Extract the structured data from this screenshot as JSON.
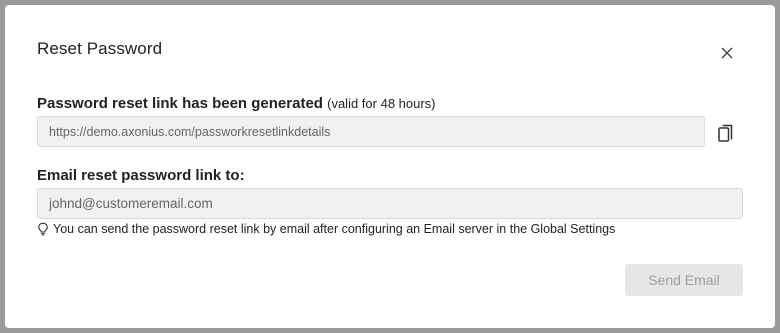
{
  "dialog": {
    "title": "Reset Password",
    "close_icon": "close-icon"
  },
  "link_section": {
    "label": "Password reset link has been generated",
    "note": "(valid for 48 hours)",
    "link_value": "https://demo.axonius.com/passworkresetlinkdetails",
    "copy_icon": "copy-icon"
  },
  "email_section": {
    "label": "Email reset password link to:",
    "email_value": "johnd@customeremail.com",
    "hint_icon": "lightbulb-icon",
    "hint": "You can send the password reset link by email after configuring an Email server in the Global Settings"
  },
  "actions": {
    "send_label": "Send Email",
    "send_disabled": true
  },
  "colors": {
    "backdrop": "#9a9a9a",
    "field_bg": "#f1f1f1",
    "button_disabled_bg": "#e6e6e6",
    "button_disabled_text": "#9e9e9e"
  }
}
